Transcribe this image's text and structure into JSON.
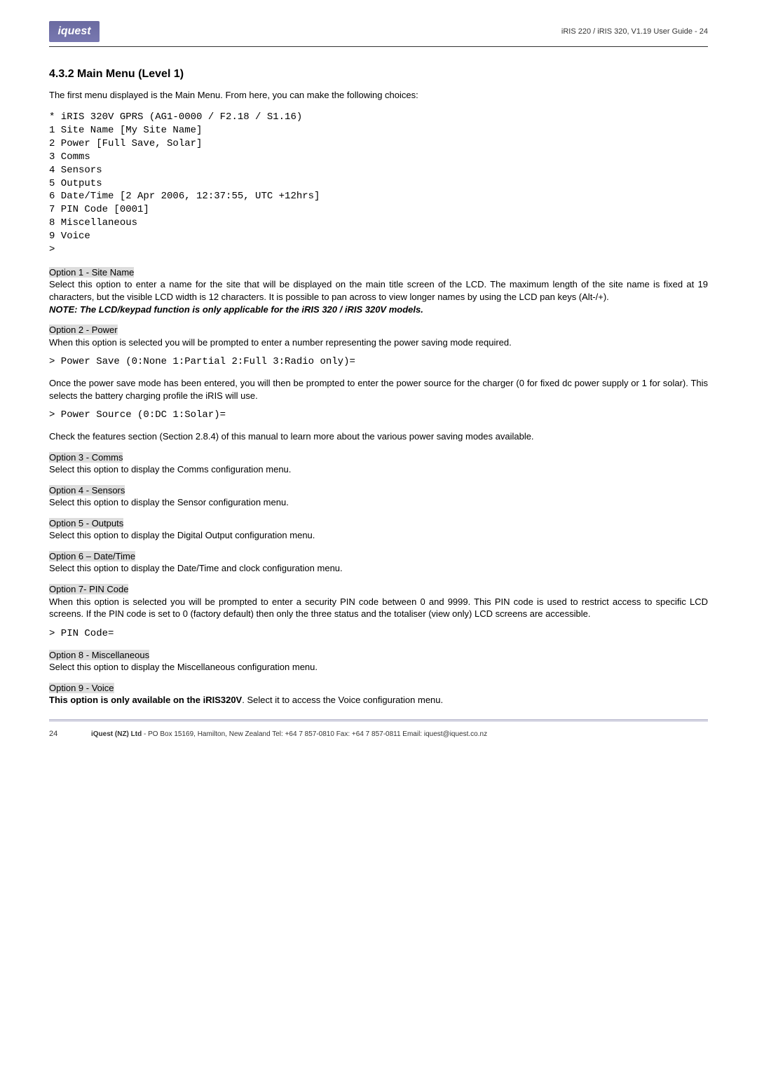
{
  "header": {
    "logo_text": "iquest",
    "right": "iRIS 220 / iRIS 320, V1.19 User Guide - 24"
  },
  "title": "4.3.2 Main Menu (Level 1)",
  "intro": "The first menu displayed is the Main Menu. From here, you can make the following choices:",
  "menu_block": "* iRIS 320V GPRS (AG1-0000 / F2.18 / S1.16)\n1 Site Name [My Site Name]\n2 Power [Full Save, Solar]\n3 Comms\n4 Sensors\n5 Outputs\n6 Date/Time [2 Apr 2006, 12:37:55, UTC +12hrs]\n7 PIN Code [0001]\n8 Miscellaneous\n9 Voice\n>",
  "opt1": {
    "title": "Option 1 - Site Name",
    "body": "Select this option to enter a name for the site that will be displayed on the main title screen of the LCD.  The maximum length of the site name is fixed at 19 characters, but the visible LCD width is 12 characters. It is possible to pan across to view longer names by using the LCD pan keys (Alt-/+).",
    "note": "NOTE: The LCD/keypad function is only applicable for the iRIS 320 / iRIS 320V models."
  },
  "opt2": {
    "title": "Option 2 - Power",
    "body1": "When this option is selected you will be prompted to enter a number representing the power saving mode required.",
    "code1": "> Power Save (0:None 1:Partial 2:Full 3:Radio only)=",
    "body2": "Once the power save mode has been entered, you will then be prompted to enter the power source for the charger (0 for fixed dc power supply or 1 for solar).  This selects the battery charging profile the iRIS will use.",
    "code2": "> Power Source (0:DC 1:Solar)=",
    "body3": "Check the features section (Section 2.8.4) of this manual to learn more about the various power saving modes available."
  },
  "opt3": {
    "title": "Option 3 - Comms",
    "body": "Select this option to display the Comms configuration menu."
  },
  "opt4": {
    "title": "Option 4 - Sensors",
    "body": "Select this option to display the Sensor configuration menu."
  },
  "opt5": {
    "title": "Option 5 - Outputs",
    "body": "Select this option to display the Digital Output configuration menu."
  },
  "opt6": {
    "title": "Option 6 – Date/Time",
    "body": "Select this option to display the Date/Time and clock configuration menu."
  },
  "opt7": {
    "title": "Option 7- PIN Code",
    "body": "When this option is selected you will be prompted to enter a security PIN code between 0 and 9999.  This PIN code is used to restrict access to specific LCD screens.  If the PIN code is set to 0 (factory default) then only the three status and the totaliser (view only) LCD screens are accessible.",
    "code": "> PIN Code="
  },
  "opt8": {
    "title": "Option 8 - Miscellaneous",
    "body": "Select this option to display the Miscellaneous configuration menu."
  },
  "opt9": {
    "title": "Option 9 - Voice",
    "bold": "This option is only available on the iRIS320V",
    "rest": ". Select it to access the Voice configuration menu."
  },
  "footer": {
    "pagenum": "24",
    "company": "iQuest (NZ) Ltd",
    "rest": "  - PO Box 15169, Hamilton, New Zealand  Tel: +64 7 857-0810  Fax: +64 7 857-0811  Email: iquest@iquest.co.nz"
  }
}
